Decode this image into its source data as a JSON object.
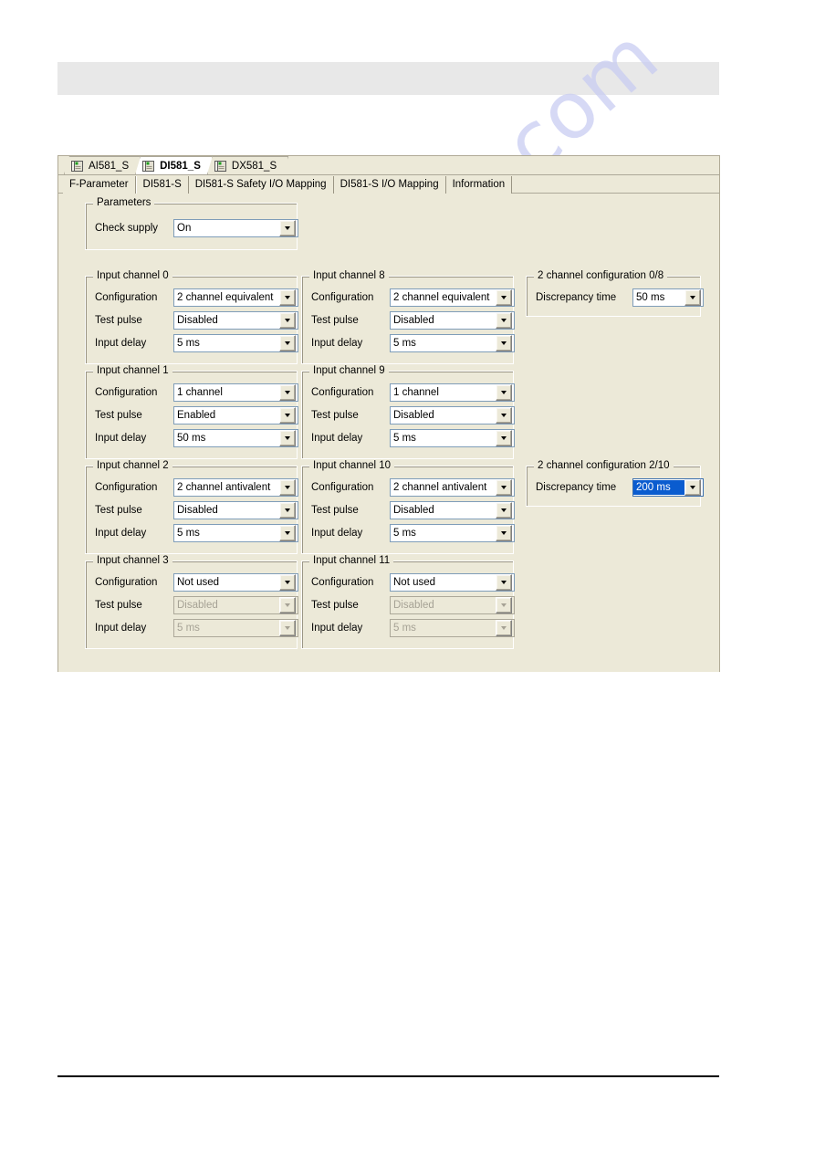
{
  "watermark": {
    "text": "manualshive.com"
  },
  "window": {
    "device_tabs": [
      {
        "label": "AI581_S",
        "icon": "module-icon",
        "active": false
      },
      {
        "label": "DI581_S",
        "icon": "module-icon",
        "active": true
      },
      {
        "label": "DX581_S",
        "icon": "module-icon",
        "active": false
      }
    ],
    "property_tabs": [
      {
        "label": "F-Parameter",
        "active": false
      },
      {
        "label": "DI581-S",
        "active": true
      },
      {
        "label": "DI581-S Safety I/O Mapping",
        "active": false
      },
      {
        "label": "DI581-S I/O Mapping",
        "active": false
      },
      {
        "label": "Information",
        "active": false
      }
    ]
  },
  "parameters_group": {
    "legend": "Parameters",
    "rows": [
      {
        "label": "Check supply",
        "value": "On",
        "state": "normal"
      }
    ]
  },
  "channel_groups": [
    {
      "legend": "Input channel 0",
      "rows": [
        {
          "label": "Configuration",
          "value": "2 channel equivalent",
          "state": "normal"
        },
        {
          "label": "Test pulse",
          "value": "Disabled",
          "state": "normal"
        },
        {
          "label": "Input delay",
          "value": "5 ms",
          "state": "normal"
        }
      ]
    },
    {
      "legend": "Input channel 1",
      "rows": [
        {
          "label": "Configuration",
          "value": "1 channel",
          "state": "normal"
        },
        {
          "label": "Test pulse",
          "value": "Enabled",
          "state": "normal"
        },
        {
          "label": "Input delay",
          "value": "50 ms",
          "state": "normal"
        }
      ]
    },
    {
      "legend": "Input channel 2",
      "rows": [
        {
          "label": "Configuration",
          "value": "2 channel antivalent",
          "state": "normal"
        },
        {
          "label": "Test pulse",
          "value": "Disabled",
          "state": "normal"
        },
        {
          "label": "Input delay",
          "value": "5 ms",
          "state": "normal"
        }
      ]
    },
    {
      "legend": "Input channel 3",
      "rows": [
        {
          "label": "Configuration",
          "value": "Not used",
          "state": "normal"
        },
        {
          "label": "Test pulse",
          "value": "Disabled",
          "state": "disabled"
        },
        {
          "label": "Input delay",
          "value": "5 ms",
          "state": "disabled"
        }
      ]
    },
    {
      "legend": "Input channel 8",
      "rows": [
        {
          "label": "Configuration",
          "value": "2 channel equivalent",
          "state": "normal"
        },
        {
          "label": "Test pulse",
          "value": "Disabled",
          "state": "normal"
        },
        {
          "label": "Input delay",
          "value": "5 ms",
          "state": "normal"
        }
      ]
    },
    {
      "legend": "Input channel 9",
      "rows": [
        {
          "label": "Configuration",
          "value": "1 channel",
          "state": "normal"
        },
        {
          "label": "Test pulse",
          "value": "Disabled",
          "state": "normal"
        },
        {
          "label": "Input delay",
          "value": "5 ms",
          "state": "normal"
        }
      ]
    },
    {
      "legend": "Input channel 10",
      "rows": [
        {
          "label": "Configuration",
          "value": "2 channel antivalent",
          "state": "normal"
        },
        {
          "label": "Test pulse",
          "value": "Disabled",
          "state": "normal"
        },
        {
          "label": "Input delay",
          "value": "5 ms",
          "state": "normal"
        }
      ]
    },
    {
      "legend": "Input channel 11",
      "rows": [
        {
          "label": "Configuration",
          "value": "Not used",
          "state": "normal"
        },
        {
          "label": "Test pulse",
          "value": "Disabled",
          "state": "disabled"
        },
        {
          "label": "Input delay",
          "value": "5 ms",
          "state": "disabled"
        }
      ]
    }
  ],
  "two_channel_groups": [
    {
      "legend": "2 channel configuration 0/8",
      "rows": [
        {
          "label": "Discrepancy time",
          "value": "50 ms",
          "state": "normal"
        }
      ]
    },
    {
      "legend": "2 channel configuration 2/10",
      "rows": [
        {
          "label": "Discrepancy time",
          "value": "200 ms",
          "state": "selected"
        }
      ]
    }
  ],
  "colors": {
    "window_face": "#ece9d8",
    "selection_blue": "#0a5ccf",
    "field_border": "#7f9db9",
    "watermark": "#c9cdf2"
  }
}
